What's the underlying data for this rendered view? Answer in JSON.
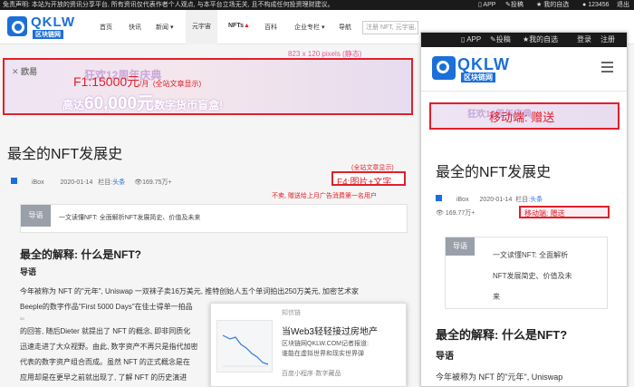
{
  "topbar": {
    "disclaimer": "免责声明: 本站为开放的资讯分享平台, 所有资讯仅代表作者个人观点, 与本平台立场无关, 且不构成任何投资理财建议。",
    "app": "APP",
    "post": "投稿",
    "my_picks": "我的自选",
    "user": "123456",
    "logout": "退出"
  },
  "logo": {
    "word": "QKLW",
    "sub": "区块链网"
  },
  "nav": {
    "items": [
      "首页",
      "快讯",
      "新闻 ▾",
      "元宇宙",
      "NFTs",
      "百科",
      "企业专栏 ▾",
      "导航"
    ],
    "search_text": "注册  NFT, 元宇宙, 百科, 导航, 新闻, 元宇宙, 百科"
  },
  "banner_size_note": "823 x 120 pixels (静态)",
  "banner": {
    "brand": "欧易",
    "price_label": "F1:15000元",
    "price_unit": "/月",
    "scope": "(全站文章显示)",
    "headline_top": "狂欢12周年庆典",
    "headline_prefix": "高达",
    "headline_amount": "60,000元",
    "headline_suffix": "数字货币盲盒!"
  },
  "article": {
    "title": "最全的NFT发展史",
    "author": "iBox",
    "date": "2020-01-14",
    "column_label": "栏目:",
    "column": "头条",
    "views": "169.75万+",
    "summary_tag": "导语",
    "summary": "一文读懂NFT: 全面解析NFT发展简史、价值及未来",
    "section_title": "最全的解释: 什么是NFT?",
    "section_sub": "导语",
    "paras": [
      "今年被称为 NFT 的\"元年\", Uniswap 一双袜子卖16万美元, 推特创始人五个单词拍出250万美元, 加密艺术家",
      "Beeple的数字作品\"First 5000 Days\"在佳士得单一拍品",
      "的回答, 随后Dieter 就提出了 NFT 的概念, 即非同质化",
      "迅速走进了大众视野。由此, 数字资产不再只是指代加密",
      "代表的数字资产组合而成。虽然 NFT 的正式概念是在",
      "应用却是在更早之前就出现了, 了解 NFT 的历史演进"
    ],
    "para_small_mark": "2021"
  },
  "f4_scope": "(全站文章显示)",
  "f4_label": "F4:图片+文字",
  "f4_note": "不卖, 赠送给上月广告消费第一名用户",
  "mobile": {
    "topbar": {
      "app": "APP",
      "post": "投稿",
      "my_picks": "我的自选",
      "login": "登录",
      "register": "注册"
    },
    "logo_word": "QKLW",
    "logo_sub": "区块链网",
    "ad_label": "移动端: 赠送",
    "ad_text": "狂欢12周年庆典",
    "title": "最全的NFT发展史",
    "author": "iBox",
    "date": "2020-01-14",
    "column_label": "栏目:",
    "column": "头条",
    "views": "169.77万+",
    "ad2_label": "移动端: 赠送",
    "summary_tag": "导语",
    "summary_lines": [
      "一文读懂NFT: 全面解析",
      "NFT发展简史、价值及未",
      "来"
    ],
    "section_title": "最全的解释: 什么是NFT?",
    "section_sub": "导语",
    "para": "今年被称为 NFT 的\"元年\", Uniswap"
  },
  "popup": {
    "source": "知信链",
    "title": "当Web3轻轻接过房地产",
    "body_lines": [
      "区块链网QKLW.COM记者报道:",
      "谁能在虚拟世界和现实世界弹"
    ],
    "footer": "百度小程序·数字藏品"
  },
  "colors": {
    "brand_blue": "#1b6fd9",
    "annotation_red": "#e0202a",
    "annotation_pink": "#e25a9a"
  }
}
